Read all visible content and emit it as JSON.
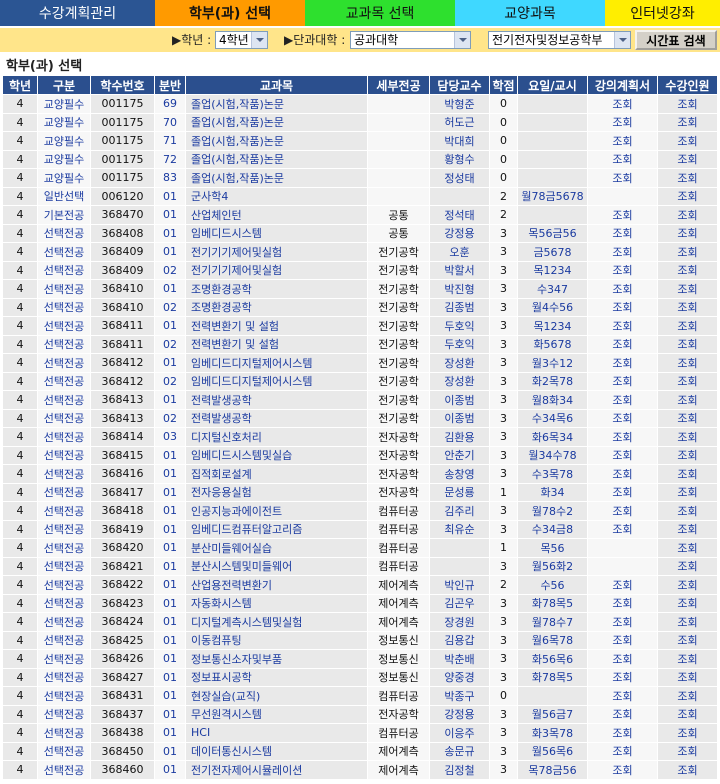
{
  "nav": {
    "tabs": [
      {
        "label": "수강계획관리",
        "bg": "#2b5593",
        "fg": "#ffffff"
      },
      {
        "label": "학부(과) 선택",
        "bg": "#ff9a00",
        "fg": "#111111"
      },
      {
        "label": "교과목 선택",
        "bg": "#2ee02e",
        "fg": "#111111"
      },
      {
        "label": "교양과목",
        "bg": "#3fd8ff",
        "fg": "#111111"
      },
      {
        "label": "인터넷강좌",
        "bg": "#ffee00",
        "fg": "#111111"
      }
    ]
  },
  "filters": {
    "grade_label": "▶학년 :",
    "grade_value": "4학년",
    "college_label": "▶단과대학 :",
    "college_value": "공과대학",
    "department_value": "전기전자및정보공학부",
    "search_button": "시간표 검색"
  },
  "section_title": "학부(과) 선택",
  "colors": {
    "filter_bar": "#ffe58a",
    "header_bg": "#2b4f8e",
    "link_text": "#1a3aa0"
  },
  "table": {
    "headers": [
      "학년",
      "구분",
      "학수번호",
      "분반",
      "교과목",
      "세부전공",
      "담당교수",
      "학점",
      "요일/교시",
      "강의계획서",
      "수강인원"
    ],
    "rows": [
      [
        "4",
        "교양필수",
        "001175",
        "69",
        "졸업(시험,작품)논문",
        "",
        "박형준",
        "0",
        "",
        "조회",
        "조회"
      ],
      [
        "4",
        "교양필수",
        "001175",
        "70",
        "졸업(시험,작품)논문",
        "",
        "허도근",
        "0",
        "",
        "조회",
        "조회"
      ],
      [
        "4",
        "교양필수",
        "001175",
        "71",
        "졸업(시험,작품)논문",
        "",
        "박대희",
        "0",
        "",
        "조회",
        "조회"
      ],
      [
        "4",
        "교양필수",
        "001175",
        "72",
        "졸업(시험,작품)논문",
        "",
        "황형수",
        "0",
        "",
        "조회",
        "조회"
      ],
      [
        "4",
        "교양필수",
        "001175",
        "83",
        "졸업(시험,작품)논문",
        "",
        "정성태",
        "0",
        "",
        "조회",
        "조회"
      ],
      [
        "4",
        "일반선택",
        "006120",
        "01",
        "군사학4",
        "",
        "",
        "2",
        "월78금5678",
        "",
        "조회"
      ],
      [
        "4",
        "기본전공",
        "368470",
        "01",
        "산업체인턴",
        "공통",
        "정석태",
        "2",
        "",
        "조회",
        "조회"
      ],
      [
        "4",
        "선택전공",
        "368408",
        "01",
        "임베디드시스템",
        "공통",
        "강정용",
        "3",
        "목56금56",
        "조회",
        "조회"
      ],
      [
        "4",
        "선택전공",
        "368409",
        "01",
        "전기기기제어및실험",
        "전기공학",
        "오훈",
        "3",
        "금5678",
        "조회",
        "조회"
      ],
      [
        "4",
        "선택전공",
        "368409",
        "02",
        "전기기기제어및실험",
        "전기공학",
        "박할서",
        "3",
        "목1234",
        "조회",
        "조회"
      ],
      [
        "4",
        "선택전공",
        "368410",
        "01",
        "조명환경공학",
        "전기공학",
        "박진형",
        "3",
        "수347",
        "조회",
        "조회"
      ],
      [
        "4",
        "선택전공",
        "368410",
        "02",
        "조명환경공학",
        "전기공학",
        "김종범",
        "3",
        "월4수56",
        "조회",
        "조회"
      ],
      [
        "4",
        "선택전공",
        "368411",
        "01",
        "전력변환기 및 설험",
        "전기공학",
        "두호익",
        "3",
        "목1234",
        "조회",
        "조회"
      ],
      [
        "4",
        "선택전공",
        "368411",
        "02",
        "전력변환기 및 설험",
        "전기공학",
        "두호익",
        "3",
        "화5678",
        "조회",
        "조회"
      ],
      [
        "4",
        "선택전공",
        "368412",
        "01",
        "임베디드디지털제어시스템",
        "전기공학",
        "장성환",
        "3",
        "월3수12",
        "조회",
        "조회"
      ],
      [
        "4",
        "선택전공",
        "368412",
        "02",
        "임베디드디지털제어시스템",
        "전기공학",
        "장성환",
        "3",
        "화2목78",
        "조회",
        "조회"
      ],
      [
        "4",
        "선택전공",
        "368413",
        "01",
        "전력발생공학",
        "전기공학",
        "이종범",
        "3",
        "월8화34",
        "조회",
        "조회"
      ],
      [
        "4",
        "선택전공",
        "368413",
        "02",
        "전력발생공학",
        "전기공학",
        "이종범",
        "3",
        "수34목6",
        "조회",
        "조회"
      ],
      [
        "4",
        "선택전공",
        "368414",
        "03",
        "디지털신호처리",
        "전자공학",
        "김환용",
        "3",
        "화6목34",
        "조회",
        "조회"
      ],
      [
        "4",
        "선택전공",
        "368415",
        "01",
        "임베디드시스템및실습",
        "전자공학",
        "안춘기",
        "3",
        "월34수78",
        "조회",
        "조회"
      ],
      [
        "4",
        "선택전공",
        "368416",
        "01",
        "집적회로설계",
        "전자공학",
        "송창영",
        "3",
        "수3목78",
        "조회",
        "조회"
      ],
      [
        "4",
        "선택전공",
        "368417",
        "01",
        "전자응용실험",
        "전자공학",
        "문성룡",
        "1",
        "화34",
        "조회",
        "조회"
      ],
      [
        "4",
        "선택전공",
        "368418",
        "01",
        "인공지능과에이전트",
        "컴퓨터공",
        "김주리",
        "3",
        "월78수2",
        "조회",
        "조회"
      ],
      [
        "4",
        "선택전공",
        "368419",
        "01",
        "임베디드컴퓨터알고리즘",
        "컴퓨터공",
        "최유순",
        "3",
        "수34금8",
        "조회",
        "조회"
      ],
      [
        "4",
        "선택전공",
        "368420",
        "01",
        "분산미들웨어실습",
        "컴퓨터공",
        "",
        "1",
        "목56",
        "",
        "조회"
      ],
      [
        "4",
        "선택전공",
        "368421",
        "01",
        "분산시스템및미들웨어",
        "컴퓨터공",
        "",
        "3",
        "월56화2",
        "",
        "조회"
      ],
      [
        "4",
        "선택전공",
        "368422",
        "01",
        "산업용전력변환기",
        "제어계측",
        "박인규",
        "2",
        "수56",
        "조회",
        "조회"
      ],
      [
        "4",
        "선택전공",
        "368423",
        "01",
        "자동화시스템",
        "제어계측",
        "김곤우",
        "3",
        "화78목5",
        "조회",
        "조회"
      ],
      [
        "4",
        "선택전공",
        "368424",
        "01",
        "디지털계측시스템및실험",
        "제어계측",
        "장경원",
        "3",
        "월78수7",
        "조회",
        "조회"
      ],
      [
        "4",
        "선택전공",
        "368425",
        "01",
        "이동컴퓨팅",
        "정보통신",
        "김용갑",
        "3",
        "월6목78",
        "조회",
        "조회"
      ],
      [
        "4",
        "선택전공",
        "368426",
        "01",
        "정보통신소자및부품",
        "정보통신",
        "박춘배",
        "3",
        "화56목6",
        "조회",
        "조회"
      ],
      [
        "4",
        "선택전공",
        "368427",
        "01",
        "정보표시공학",
        "정보통신",
        "양중경",
        "3",
        "화78목5",
        "조회",
        "조회"
      ],
      [
        "4",
        "선택전공",
        "368431",
        "01",
        "현장실습(교직)",
        "컴퓨터공",
        "박종구",
        "0",
        "",
        "조회",
        "조회"
      ],
      [
        "4",
        "선택전공",
        "368437",
        "01",
        "무선원격시스템",
        "전자공학",
        "강정용",
        "3",
        "월56금7",
        "조회",
        "조회"
      ],
      [
        "4",
        "선택전공",
        "368438",
        "01",
        "HCI",
        "컴퓨터공",
        "이응주",
        "3",
        "화3목78",
        "조회",
        "조회"
      ],
      [
        "4",
        "선택전공",
        "368450",
        "01",
        "데이터통신시스템",
        "제어계측",
        "송문규",
        "3",
        "월56목6",
        "조회",
        "조회"
      ],
      [
        "4",
        "선택전공",
        "368460",
        "01",
        "전기전자제어시뮬레이션",
        "제어계측",
        "김정철",
        "3",
        "목78금56",
        "조회",
        "조회"
      ]
    ]
  }
}
